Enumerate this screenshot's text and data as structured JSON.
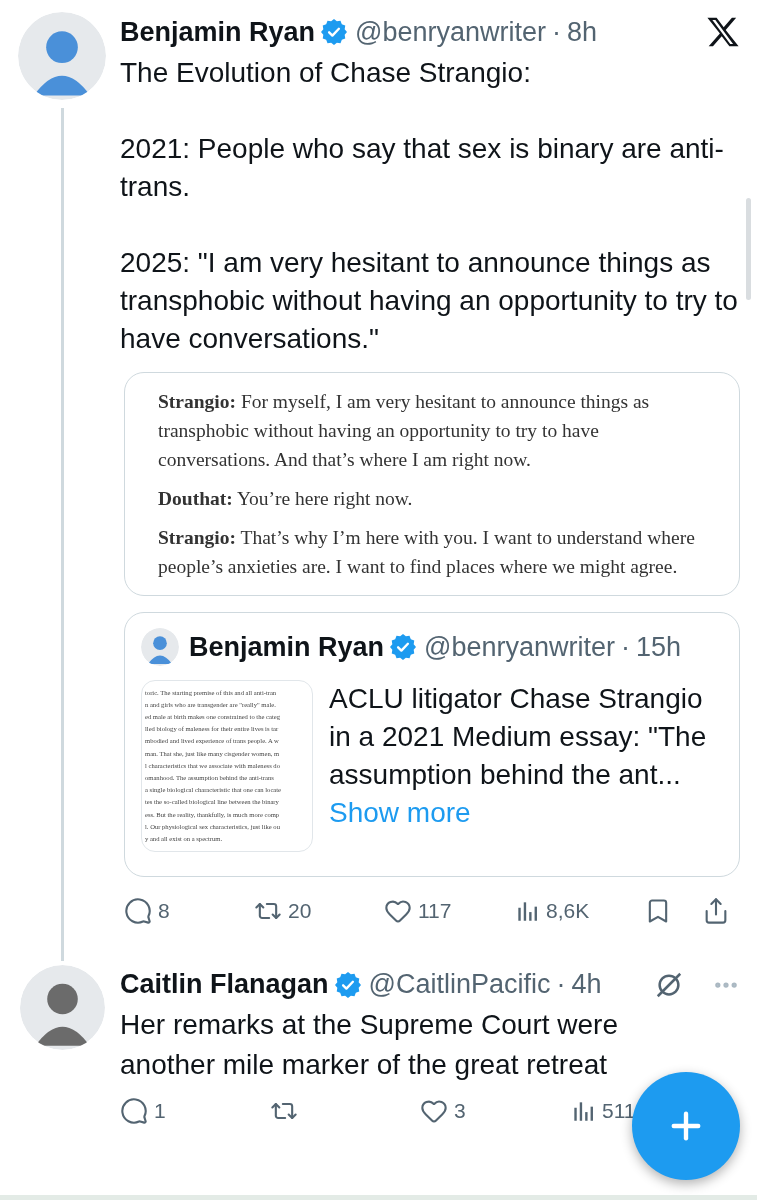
{
  "tweet": {
    "author": "Benjamin Ryan",
    "verified": true,
    "handle": "@benryanwriter",
    "separator": "·",
    "time": "8h",
    "paragraphs": [
      "The Evolution of Chase Strangio:",
      "2021: People who say that sex is binary are anti-trans.",
      "2025: \"I am very hesitant to announce things as transphobic without having an opportunity to try to have conversations.\""
    ],
    "media": {
      "paragraphs": [
        "**Strangio:** For myself, I am very hesitant to announce things as transphobic without having an opportunity to try to have conversations. And that’s where I am right now.",
        "**Douthat:** You’re here right now.",
        "**Strangio:** That’s why I’m here with you. I want to understand where people’s anxieties are. I want to find places where we might agree."
      ]
    },
    "quote": {
      "author": "Benjamin Ryan",
      "verified": true,
      "handle": "@benryanwriter",
      "separator": "·",
      "time": "15h",
      "thumbnail_lines": [
        "toric. The starting premise of this and all anti-tran",
        "n and girls who are transgender are \"really\" male.",
        "ed male at birth makes one constrained to the categ",
        "lled biology of maleness for their entire lives is tar",
        "mbodied and lived experience of trans people. A w",
        "man. That she, just like many cisgender women, m",
        "l characteristics that we associate with maleness do",
        "omanhood. The assumption behind the anti-trans",
        "a single biological characteristic that one can locate",
        "tes the so-called biological line between the binary",
        "ess. But the reality, thankfully, is much more comp",
        "l. Our physiological sex characteristics, just like ou",
        "y and all exist on a spectrum."
      ],
      "text": "ACLU litigator Chase Strangio in a 2021 Medium essay: \"The assumption behind the ant...",
      "show_more": "Show more"
    },
    "actions": [
      {
        "kind": "reply",
        "count": "8"
      },
      {
        "kind": "repost",
        "count": "20"
      },
      {
        "kind": "like",
        "count": "117"
      },
      {
        "kind": "views",
        "count": "8,6K"
      },
      {
        "kind": "bookmark"
      },
      {
        "kind": "share"
      }
    ]
  },
  "reply_tweet": {
    "author": "Caitlin Flanagan",
    "verified": true,
    "handle": "@CaitlinPacific",
    "separator": "·",
    "time": "4h",
    "text": "Her remarks at the Supreme Court were another mile marker of the great retreat",
    "actions": [
      {
        "kind": "reply",
        "count": "1"
      },
      {
        "kind": "repost"
      },
      {
        "kind": "like",
        "count": "3"
      },
      {
        "kind": "views",
        "count": "511"
      }
    ]
  }
}
